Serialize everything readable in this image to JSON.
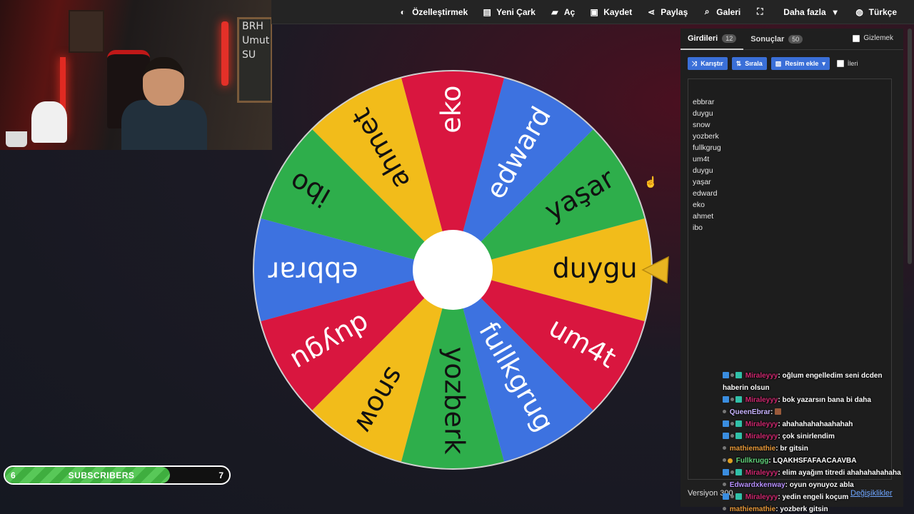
{
  "nav": {
    "items": [
      {
        "label": "Özelleştirmek",
        "icon": "palette-icon",
        "glyph": "◐"
      },
      {
        "label": "Yeni Çark",
        "icon": "file-icon",
        "glyph": "▤"
      },
      {
        "label": "Aç",
        "icon": "folder-icon",
        "glyph": "▰"
      },
      {
        "label": "Kaydet",
        "icon": "save-icon",
        "glyph": "▣"
      },
      {
        "label": "Paylaş",
        "icon": "share-icon",
        "glyph": "⋖"
      },
      {
        "label": "Galeri",
        "icon": "search-icon",
        "glyph": "⌕"
      },
      {
        "label": "",
        "icon": "fullscreen-icon",
        "glyph": "⛶"
      },
      {
        "label": "Daha fazla",
        "icon": "chevron-down-icon",
        "glyph": "▾"
      },
      {
        "label": "Türkçe",
        "icon": "globe-icon",
        "glyph": "◍"
      }
    ]
  },
  "webcam": {
    "board_lines": [
      "BRH",
      "Umut",
      "SU"
    ]
  },
  "wheel": {
    "colors": [
      "#e8b521",
      "#d9163f",
      "#3d72e0",
      "#2eae4b"
    ],
    "segments": [
      "duygu",
      "yaşar",
      "edward",
      "eko",
      "ahmet",
      "ibo",
      "ebbrar",
      "duygu",
      "snow",
      "yozberk",
      "fullkgrug",
      "um4t"
    ],
    "segment_colors": [
      "#f2bc1a",
      "#2eae4b",
      "#3d72e0",
      "#d9163f",
      "#f2bc1a",
      "#2eae4b",
      "#3d72e0",
      "#d9163f",
      "#f2bc1a",
      "#2eae4b",
      "#3d72e0",
      "#d9163f"
    ]
  },
  "panel": {
    "tab_entries": "Girdileri",
    "tab_entries_count": "12",
    "tab_results": "Sonuçlar",
    "tab_results_count": "50",
    "hide_label": "Gizlemek",
    "btn_shuffle": "Karıştır",
    "btn_sort": "Sırala",
    "btn_add_image": "Resim ekle",
    "advanced_label": "İleri",
    "entries": [
      "ebbrar",
      "duygu",
      "snow",
      "yozberk",
      "fullkgrug",
      "um4t",
      "duygu",
      "yaşar",
      "edward",
      "eko",
      "ahmet",
      "ibo"
    ],
    "version": "Versiyon 300",
    "changes": "Değişiklikler"
  },
  "chat": [
    {
      "user": "Miraleyyy",
      "cls": "n-pink",
      "badges": [
        "ic-blue",
        "ic-gray",
        "ic-teal"
      ],
      "msg": ": oğlum engelledim seni dcden haberin olsun"
    },
    {
      "user": "Miraleyyy",
      "cls": "n-pink",
      "badges": [
        "ic-blue",
        "ic-gray",
        "ic-teal"
      ],
      "msg": ": bok yazarsın bana bi daha"
    },
    {
      "user": "QueenEbrar",
      "cls": "n-lav",
      "badges": [
        "ic-gray"
      ],
      "msg": ": ",
      "emote": true
    },
    {
      "user": "Miraleyyy",
      "cls": "n-pink",
      "badges": [
        "ic-blue",
        "ic-gray",
        "ic-teal"
      ],
      "msg": ": ahahahahahaahahah"
    },
    {
      "user": "Miraleyyy",
      "cls": "n-pink",
      "badges": [
        "ic-blue",
        "ic-gray",
        "ic-teal"
      ],
      "msg": ": çok sinirlendim"
    },
    {
      "user": "mathiemathie",
      "cls": "n-orange",
      "badges": [
        "ic-gray"
      ],
      "msg": ": br gitsin"
    },
    {
      "user": "Fullkrugg",
      "cls": "n-green",
      "badges": [
        "ic-gray",
        "ic-gold"
      ],
      "msg": ": LQAKHSFAFAACAAVBA"
    },
    {
      "user": "Miraleyyy",
      "cls": "n-pink",
      "badges": [
        "ic-blue",
        "ic-gray",
        "ic-teal"
      ],
      "msg": ": elim ayağım titredi ahahahahahaha"
    },
    {
      "user": "Edwardxkenway",
      "cls": "n-purple",
      "badges": [
        "ic-gray"
      ],
      "msg": ": oyun oynuyoz abla"
    },
    {
      "user": "Miraleyyy",
      "cls": "n-pink",
      "badges": [
        "ic-blue",
        "ic-gray",
        "ic-teal"
      ],
      "msg": ": yedin engeli koçum"
    },
    {
      "user": "mathiemathie",
      "cls": "n-orange",
      "badges": [
        "ic-gray"
      ],
      "msg": ": yozberk gitsin"
    }
  ],
  "subs": {
    "current": "6",
    "label": "SUBSCRIBERS",
    "goal": "7",
    "progress": 0.857
  }
}
